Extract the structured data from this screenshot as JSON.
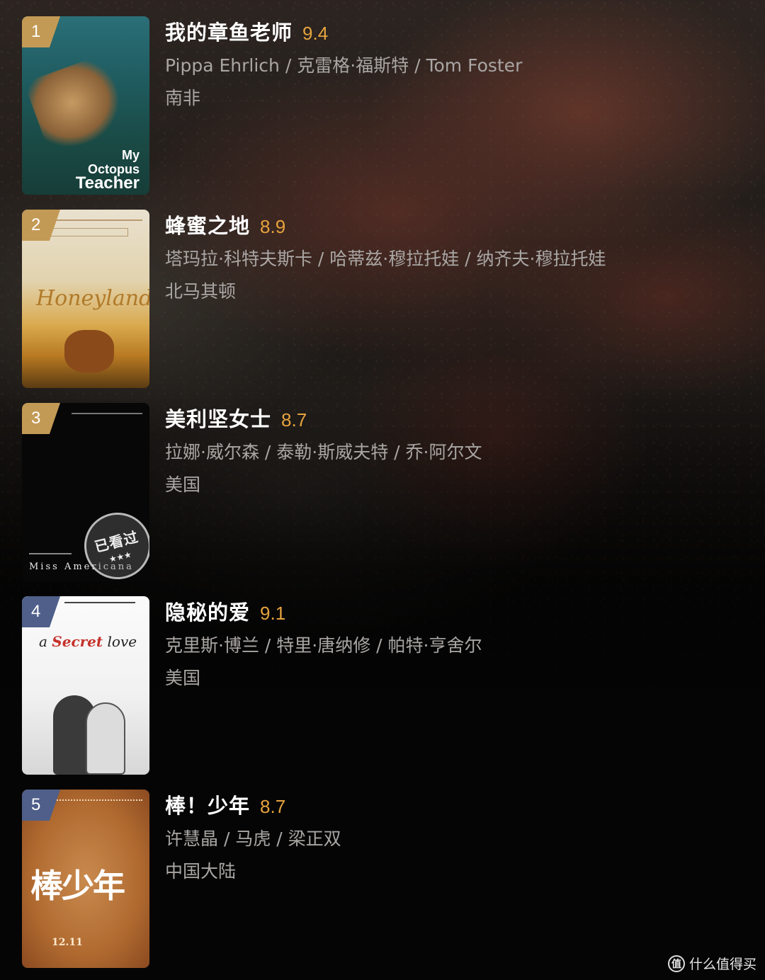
{
  "items": [
    {
      "rank": "1",
      "title": "我的章鱼老师",
      "rating": "9.4",
      "people": "Pippa Ehrlich / 克雷格·福斯特 / Tom Foster",
      "region": "南非",
      "rank_color": "#c39a55",
      "poster": {
        "line1": "My",
        "line2": "Octopus",
        "line3": "Teacher"
      }
    },
    {
      "rank": "2",
      "title": "蜂蜜之地",
      "rating": "8.9",
      "people": "塔玛拉·科特夫斯卡 / 哈蒂兹·穆拉托娃 / 纳齐夫·穆拉托娃",
      "region": "北马其顿",
      "rank_color": "#c39a55",
      "poster": {
        "title": "Honeyland"
      }
    },
    {
      "rank": "3",
      "title": "美利坚女士",
      "rating": "8.7",
      "people": "拉娜·威尔森 / 泰勒·斯威夫特 / 乔·阿尔文",
      "region": "美国",
      "rank_color": "#c39a55",
      "poster": {
        "title": "Miss Americana"
      },
      "stamp": {
        "text": "已看过",
        "stars": "★★★"
      }
    },
    {
      "rank": "4",
      "title": "隐秘的爱",
      "rating": "9.1",
      "people": "克里斯·博兰 / 特里·唐纳修 / 帕特·亨舍尔",
      "region": "美国",
      "rank_color": "#4f5f8a",
      "poster": {
        "pre": "a",
        "red": "Secret",
        "post": "love"
      }
    },
    {
      "rank": "5",
      "title": "棒！少年",
      "rating": "8.7",
      "people": "许慧晶 / 马虎 / 梁正双",
      "region": "中国大陆",
      "rank_color": "#4f5f8a",
      "poster": {
        "title": "棒少年",
        "date": "12.11"
      }
    }
  ],
  "watermark": {
    "icon": "值",
    "text": "什么值得买"
  },
  "colors": {
    "rating": "#e6a33e",
    "meta": "#a9a6a4",
    "title": "#ffffff"
  }
}
